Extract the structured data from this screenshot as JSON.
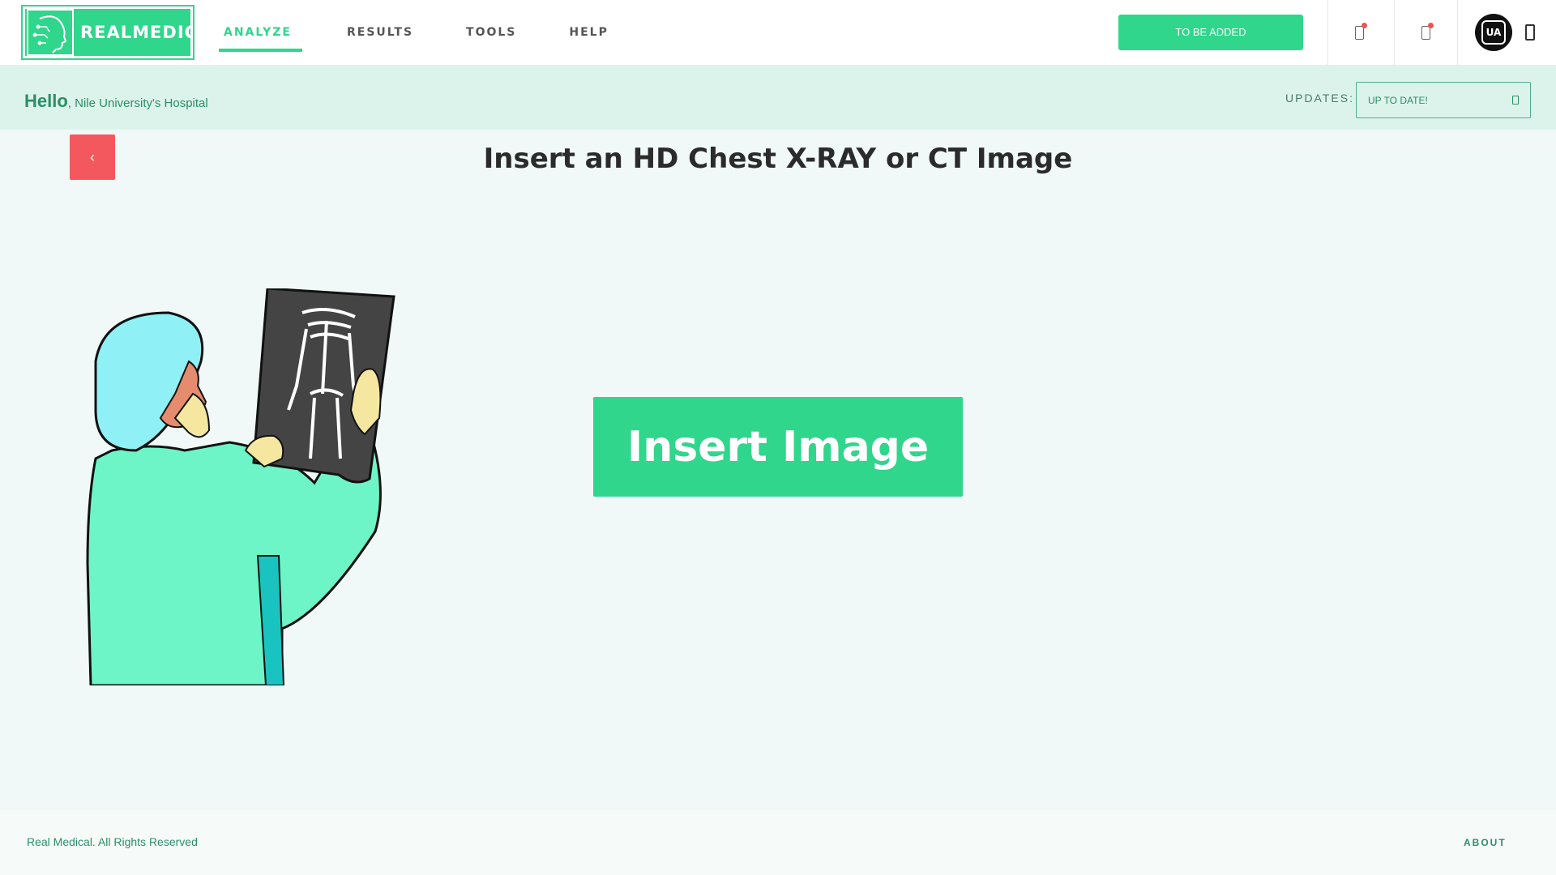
{
  "app": {
    "logo_text": "REALMEDICAL",
    "brand_color": "#2fd68b",
    "danger_color": "#f2585e"
  },
  "nav": {
    "items": [
      {
        "label": "ANALYZE",
        "active": true
      },
      {
        "label": "RESULTS",
        "active": false
      },
      {
        "label": "TOOLS",
        "active": false
      },
      {
        "label": "HELP",
        "active": false
      }
    ]
  },
  "header": {
    "tba_button": "TO BE ADDED",
    "avatar_initials": "UA"
  },
  "greeting": {
    "hello": "Hello",
    "name": ", Nile University's Hospital",
    "updates_label": "UPDATES:",
    "updates_value": "UP TO DATE!"
  },
  "main": {
    "back_glyph": "‹",
    "title": "Insert an HD Chest X-RAY or CT Image",
    "insert_button": "Insert Image"
  },
  "footer": {
    "copyright": "Real Medical. All Rights Reserved",
    "about": "ABOUT"
  }
}
